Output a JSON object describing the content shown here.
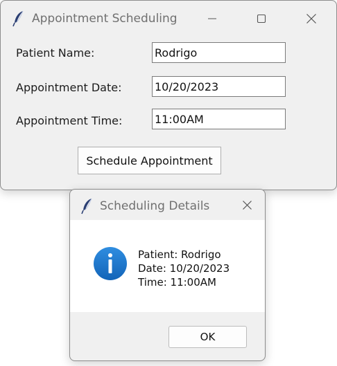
{
  "main_window": {
    "title": "Appointment Scheduling",
    "fields": [
      {
        "label": "Patient Name:",
        "value": "Rodrigo"
      },
      {
        "label": "Appointment Date:",
        "value": "10/20/2023"
      },
      {
        "label": "Appointment Time:",
        "value": "11:00AM"
      }
    ],
    "schedule_button": "Schedule Appointment"
  },
  "dialog": {
    "title": "Scheduling Details",
    "lines": [
      "Patient: Rodrigo",
      "Date: 10/20/2023",
      "Time: 11:00AM"
    ],
    "ok_button": "OK",
    "icon": "info-icon"
  },
  "colors": {
    "window_bg": "#f0f0f0",
    "info_blue": "#1a73c8"
  }
}
